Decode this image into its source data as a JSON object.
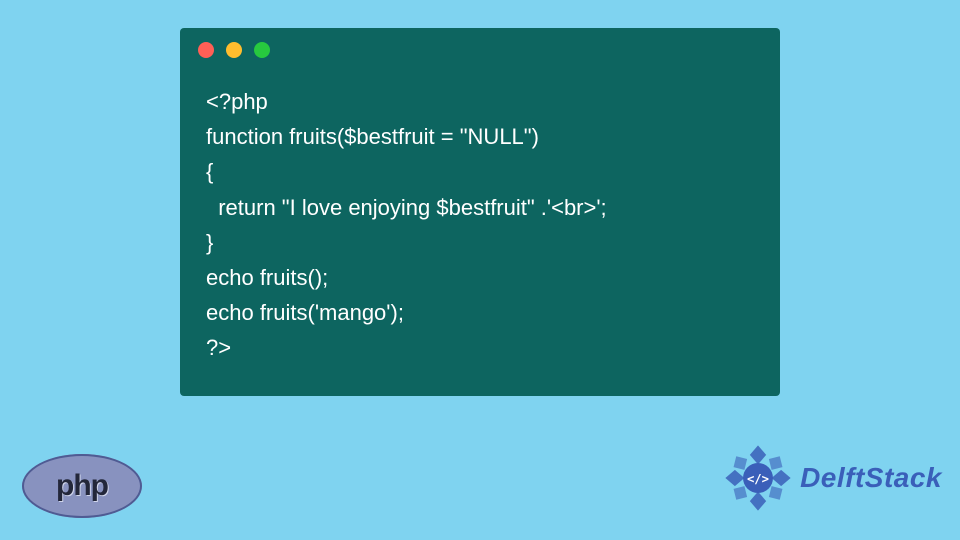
{
  "code": {
    "lines": [
      "<?php",
      "function fruits($bestfruit = \"NULL\")",
      "{",
      "  return \"I love enjoying $bestfruit\" .'<br>';",
      "}",
      "echo fruits();",
      "echo fruits('mango');",
      "?>"
    ]
  },
  "php_badge": {
    "label": "php"
  },
  "delft": {
    "label": "DelftStack"
  },
  "colors": {
    "background": "#7fd3f0",
    "window": "#0d6560",
    "code_text": "#ffffff",
    "php_oval": "#8892bf",
    "delft_text": "#3a5fb9"
  }
}
